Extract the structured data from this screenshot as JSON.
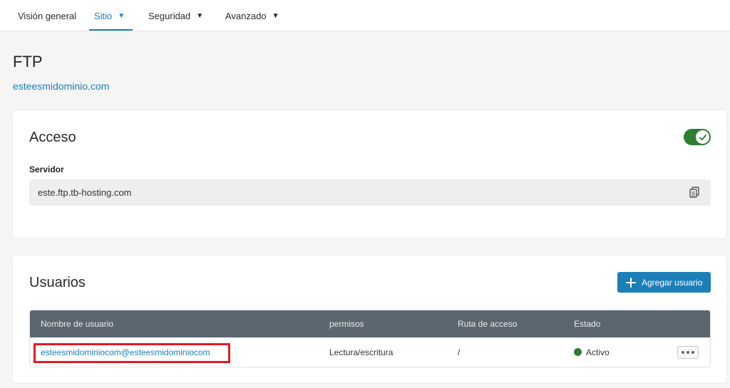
{
  "nav": {
    "items": [
      {
        "label": "Visión general",
        "has_caret": false,
        "active": false
      },
      {
        "label": "Sitio",
        "has_caret": true,
        "active": true
      },
      {
        "label": "Seguridad",
        "has_caret": true,
        "active": false
      },
      {
        "label": "Avanzado",
        "has_caret": true,
        "active": false
      }
    ],
    "caret": "▼"
  },
  "page": {
    "title": "FTP",
    "domain": "esteesmidominio.com"
  },
  "access": {
    "title": "Acceso",
    "toggle_on": true,
    "server_label": "Servidor",
    "server_value": "este.ftp.tb-hosting.com",
    "copy_icon": "copy-icon"
  },
  "users": {
    "title": "Usuarios",
    "add_button": "Agregar usuario",
    "columns": [
      "Nombre de usuario",
      "permisos",
      "Ruta de acceso",
      "Estado"
    ],
    "rows": [
      {
        "username": "esteesmidominiocom@esteesmidominiocom",
        "permissions": "Lectura/escritura",
        "path": "/",
        "status": "Activo",
        "status_color": "#2e7d32"
      }
    ]
  },
  "colors": {
    "accent": "#1d7fb8",
    "toggle_on": "#2e7d32",
    "table_header": "#5b6670",
    "highlight": "#e01b24"
  }
}
